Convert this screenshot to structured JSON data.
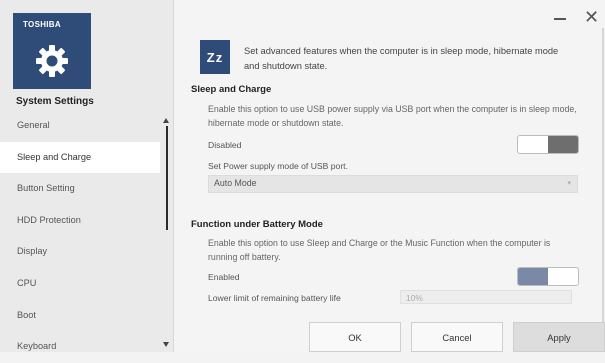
{
  "sidebar": {
    "brand": "TOSHIBA",
    "app_title": "System Settings",
    "items": [
      {
        "label": "General"
      },
      {
        "label": "Sleep and Charge",
        "active": true
      },
      {
        "label": "Button Setting"
      },
      {
        "label": "HDD Protection"
      },
      {
        "label": "Display"
      },
      {
        "label": "CPU"
      },
      {
        "label": "Boot"
      },
      {
        "label": "Keyboard"
      }
    ]
  },
  "window": {
    "minimize_icon": "minimize-icon",
    "close_label": "✕"
  },
  "header": {
    "icon_text": "Zz",
    "intro": "Set advanced features when the computer is in sleep mode, hibernate mode and shutdown state."
  },
  "sleep_charge": {
    "title": "Sleep and Charge",
    "description": "Enable this option to use USB power supply via USB port when the computer is in sleep mode, hibernate mode or shutdown state.",
    "state_label": "Disabled",
    "supply_mode_label": "Set Power supply mode of USB port.",
    "supply_mode_value": "Auto Mode"
  },
  "battery_mode": {
    "title": "Function under Battery Mode",
    "description": "Enable this option to use Sleep and Charge or the Music Function when the computer is running off battery.",
    "state_label": "Enabled",
    "lower_limit_label": "Lower limit of remaining battery life",
    "lower_limit_value": "10%"
  },
  "footer": {
    "ok": "OK",
    "cancel": "Cancel",
    "apply": "Apply"
  },
  "colors": {
    "accent": "#2f4c79",
    "toggle_off": "#6e6e6e",
    "toggle_on": "#7a8aa6"
  }
}
